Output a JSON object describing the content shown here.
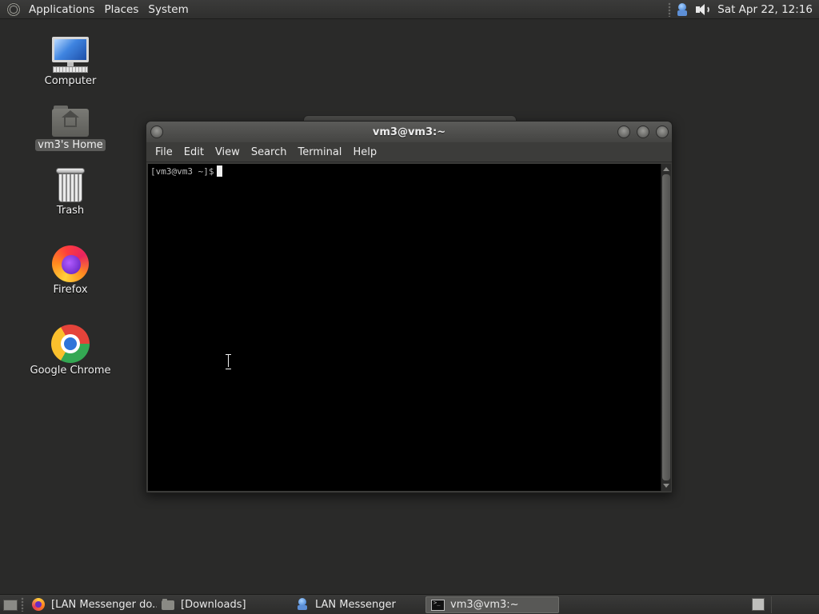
{
  "top_panel": {
    "menus": [
      "Applications",
      "Places",
      "System"
    ],
    "clock": "Sat Apr 22, 12:16"
  },
  "desktop": {
    "icons": [
      {
        "label": "Computer",
        "icon": "computer-icon"
      },
      {
        "label": "vm3's Home",
        "icon": "home-folder-icon",
        "selected": true
      },
      {
        "label": "Trash",
        "icon": "trash-icon"
      },
      {
        "label": "Firefox",
        "icon": "firefox-icon"
      },
      {
        "label": "Google Chrome",
        "icon": "chrome-icon"
      }
    ]
  },
  "terminal": {
    "title": "vm3@vm3:~",
    "menu": [
      "File",
      "Edit",
      "View",
      "Search",
      "Terminal",
      "Help"
    ],
    "prompt": "[vm3@vm3 ~]$"
  },
  "taskbar": {
    "tasks": [
      {
        "label": "[LAN Messenger do...",
        "icon": "firefox-icon",
        "active": false
      },
      {
        "label": "[Downloads]",
        "icon": "folder-icon",
        "active": false
      },
      {
        "label": "LAN Messenger",
        "icon": "lan-messenger-icon",
        "active": false
      },
      {
        "label": "vm3@vm3:~",
        "icon": "terminal-icon",
        "active": true
      }
    ]
  },
  "colors": {
    "desktop_bg": "#2a2a29",
    "panel_bg": "#333332",
    "terminal_bg": "#000000",
    "active_task": "#585856"
  }
}
